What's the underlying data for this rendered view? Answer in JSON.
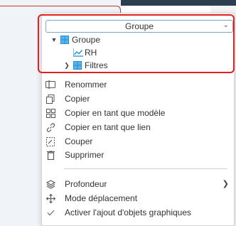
{
  "dropdown": {
    "selected": "Groupe"
  },
  "tree": {
    "root": {
      "label": "Groupe",
      "icon": "grid-icon",
      "expanded": true
    },
    "child_rh": {
      "label": "RH",
      "icon": "line-chart-icon"
    },
    "child_filtres": {
      "label": "Filtres",
      "icon": "grid-icon",
      "expanded": false
    }
  },
  "menu": {
    "items": [
      {
        "label": "Renommer",
        "icon": "rename-icon"
      },
      {
        "label": "Copier",
        "icon": "copy-icon"
      },
      {
        "label": "Copier en tant que modèle",
        "icon": "copy-template-icon"
      },
      {
        "label": "Copier en tant que lien",
        "icon": "link-icon"
      },
      {
        "label": "Couper",
        "icon": "cut-icon"
      },
      {
        "label": "Supprimer",
        "icon": "trash-icon"
      }
    ],
    "items2": [
      {
        "label": "Profondeur",
        "icon": "layers-icon",
        "has_submenu": true
      },
      {
        "label": "Mode déplacement",
        "icon": "move-icon"
      },
      {
        "label": "Activer l'ajout d'objets graphiques",
        "icon": "check-icon"
      }
    ]
  },
  "colors": {
    "accent_blue": "#1f8fd6",
    "highlight_red": "#e0211f",
    "text": "#333333"
  }
}
